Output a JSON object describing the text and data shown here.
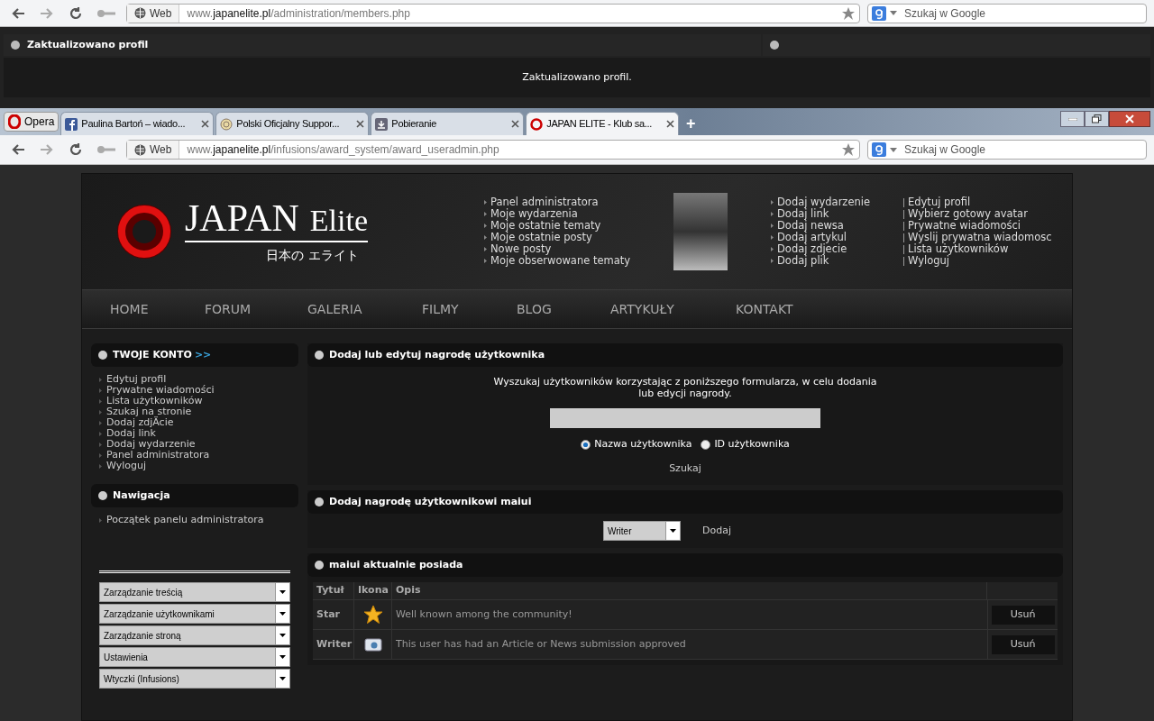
{
  "back_window": {
    "toolbar": {
      "web_label": "Web",
      "address": "www.**japanelite.pl**/administration/members.php",
      "search_placeholder": "Szukaj w Google"
    },
    "panels": [
      {
        "title": "Zaktualizowano profil",
        "message": "Zaktualizowano profil."
      }
    ]
  },
  "front_window": {
    "opera_button": "Opera",
    "tabs": [
      {
        "label": "Paulina Bartoń – wiado...",
        "selected": false
      },
      {
        "label": "Polski Oficjalny Suppor...",
        "selected": false
      },
      {
        "label": "Pobieranie",
        "selected": false
      },
      {
        "label": "JAPAN ELITE - Klub sa...",
        "selected": true
      }
    ],
    "new_tab": "+",
    "toolbar": {
      "web_label": "Web",
      "address": "www.**japanelite.pl**/infusions/award_system/award_useradmin.php",
      "search_placeholder": "Szukaj w Google"
    }
  },
  "site": {
    "logo": {
      "word1": "JAPAN",
      "word2": "Elite",
      "subtitle": "日本の エライト"
    },
    "header_links": [
      [
        "Panel administratora",
        "Moje wydarzenia",
        "Moje ostatnie tematy",
        "Moje ostatnie posty",
        "Nowe posty",
        "Moje obserwowane tematy"
      ],
      [
        "Dodaj wydarzenie",
        "Dodaj link",
        "Dodaj newsa",
        "Dodaj artykul",
        "Dodaj zdjecie",
        "Dodaj plik"
      ],
      [
        "Edytuj profil",
        "Wybierz gotowy avatar",
        "Prywatne wiadomości",
        "Wyslij prywatna wiadomosc",
        "Lista użytkowników",
        "Wyloguj"
      ]
    ],
    "nav": [
      "HOME",
      "FORUM",
      "GALERIA",
      "FILMY",
      "BLOG",
      "ARTYKUŁY",
      "KONTAKT"
    ],
    "sidebar": [
      {
        "title": "TWOJE KONTO",
        "title_suffix": ">>",
        "items": [
          "Edytuj profil",
          "Prywatne wiadomości",
          "Lista użytkowników",
          "Szukaj na stronie",
          "Dodaj zdjÄcie",
          "Dodaj link",
          "Dodaj wydarzenie",
          "Panel administratora",
          "Wyloguj"
        ]
      },
      {
        "title": "Nawigacja",
        "items": [
          "Początek panelu administratora"
        ]
      }
    ],
    "admin_selects": [
      "Zarządzanie treścią",
      "Zarządzanie użytkownikami",
      "Zarządzanie stroną",
      "Ustawienia",
      "Wtyczki (Infusions)"
    ],
    "search_panel": {
      "title": "Dodaj lub edytuj nagrodę użytkownika",
      "intro": "Wyszukaj użytkowników korzystając z poniższego formularza, w celu dodania lub edycji nagrody.",
      "options": [
        {
          "label": "Nazwa użytkownika",
          "selected": true
        },
        {
          "label": "ID użytkownika",
          "selected": false
        }
      ],
      "button": "Szukaj"
    },
    "add_panel": {
      "title": "Dodaj nagrodę użytkownikowi maiui",
      "select_value": "Writer",
      "button": "Dodaj"
    },
    "owned_panel": {
      "title": "maiui aktualnie posiada",
      "columns": [
        "Tytuł",
        "Ikona",
        "Opis"
      ],
      "rows": [
        {
          "title": "Star",
          "description": "Well known among the community!",
          "action": "Usuń"
        },
        {
          "title": "Writer",
          "description": "This user has had an Article or News submission approved",
          "action": "Usuń"
        }
      ]
    }
  }
}
